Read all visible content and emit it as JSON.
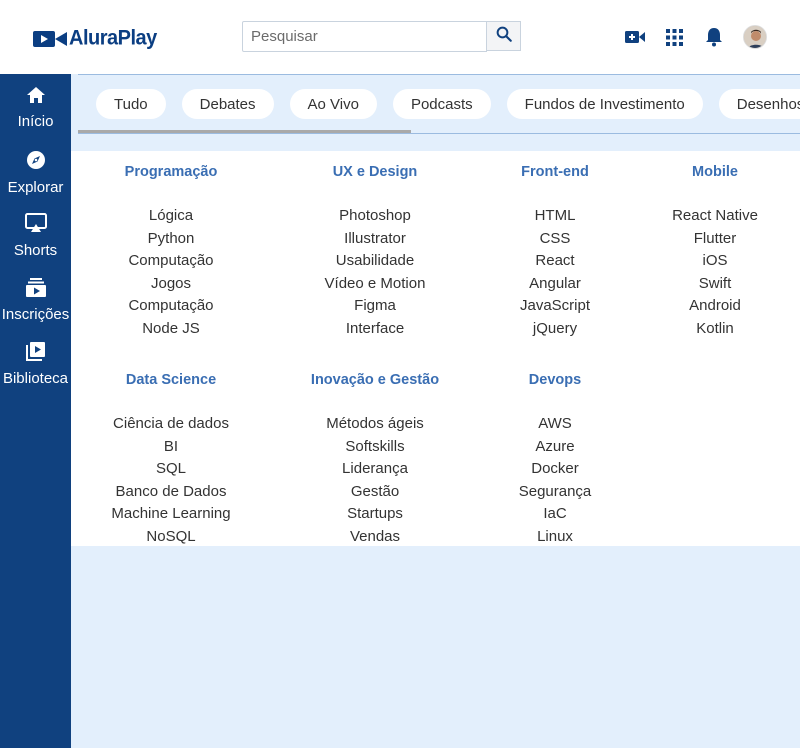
{
  "header": {
    "logo_text": "AluraPlay",
    "search": {
      "placeholder": "Pesquisar",
      "value": ""
    },
    "icons": [
      "video-add-icon",
      "apps-grid-icon",
      "bell-icon",
      "avatar"
    ]
  },
  "sidebar": {
    "items": [
      {
        "label": "Início",
        "icon": "home-icon"
      },
      {
        "label": "Explorar",
        "icon": "compass-icon"
      },
      {
        "label": "Shorts",
        "icon": "shorts-icon"
      },
      {
        "label": "Inscrições",
        "icon": "subscriptions-icon"
      },
      {
        "label": "Biblioteca",
        "icon": "library-icon"
      }
    ]
  },
  "chips": [
    "Tudo",
    "Debates",
    "Ao Vivo",
    "Podcasts",
    "Fundos de Investimento",
    "Desenhos"
  ],
  "categories": [
    {
      "title": "Programação",
      "links": [
        "Lógica",
        "Python",
        "Computação",
        "Jogos",
        "Computação",
        "Node JS"
      ]
    },
    {
      "title": "UX e Design",
      "links": [
        "Photoshop",
        "Illustrator",
        "Usabilidade",
        "Vídeo e Motion",
        "Figma",
        "Interface"
      ]
    },
    {
      "title": "Front-end",
      "links": [
        "HTML",
        "CSS",
        "React",
        "Angular",
        "JavaScript",
        "jQuery"
      ]
    },
    {
      "title": "Mobile",
      "links": [
        "React Native",
        "Flutter",
        "iOS",
        "Swift",
        "Android",
        "Kotlin"
      ]
    },
    {
      "title": "Data Science",
      "links": [
        "Ciência de dados",
        "BI",
        "SQL",
        "Banco de Dados",
        "Machine Learning",
        "NoSQL"
      ]
    },
    {
      "title": "Inovação e Gestão",
      "links": [
        "Métodos ágeis",
        "Softskills",
        "Liderança",
        "Gestão",
        "Startups",
        "Vendas"
      ]
    },
    {
      "title": "Devops",
      "links": [
        "AWS",
        "Azure",
        "Docker",
        "Segurança",
        "IaC",
        "Linux"
      ]
    }
  ],
  "colors": {
    "sidebar": "#10417f",
    "accent": "#3a6eb3",
    "background": "#e3effc",
    "logo": "#0b3e82"
  }
}
